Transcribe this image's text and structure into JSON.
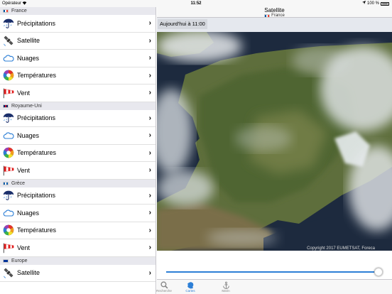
{
  "status": {
    "carrier": "Opérateur",
    "time": "11:52",
    "battery": "100 %"
  },
  "nav": {
    "title": "Satellite",
    "subtitle": "France"
  },
  "time_label": "Aujourd'hui à 11:00",
  "copyright": "Copyright 2017 EUMETSAT, Foreca",
  "sections": [
    {
      "name": "France",
      "flag": [
        "#0055a4",
        "#ffffff",
        "#ef4135"
      ],
      "items": [
        {
          "label": "Précipitations",
          "icon": "umbrella-icon"
        },
        {
          "label": "Satellite",
          "icon": "satellite-icon"
        },
        {
          "label": "Nuages",
          "icon": "cloud-icon"
        },
        {
          "label": "Températures",
          "icon": "color-wheel-icon"
        },
        {
          "label": "Vent",
          "icon": "windsock-icon"
        }
      ]
    },
    {
      "name": "Royaume-Uni",
      "flag": [
        "#012169",
        "#c8102e",
        "#012169"
      ],
      "items": [
        {
          "label": "Précipitations",
          "icon": "umbrella-icon"
        },
        {
          "label": "Nuages",
          "icon": "cloud-icon"
        },
        {
          "label": "Températures",
          "icon": "color-wheel-icon"
        },
        {
          "label": "Vent",
          "icon": "windsock-icon"
        }
      ]
    },
    {
      "name": "Grèce",
      "flag": [
        "#0d5eaf",
        "#ffffff",
        "#0d5eaf"
      ],
      "items": [
        {
          "label": "Précipitations",
          "icon": "umbrella-icon"
        },
        {
          "label": "Nuages",
          "icon": "cloud-icon"
        },
        {
          "label": "Températures",
          "icon": "color-wheel-icon"
        },
        {
          "label": "Vent",
          "icon": "windsock-icon"
        }
      ]
    },
    {
      "name": "Europe",
      "flag": [
        "#003399",
        "#003399",
        "#003399"
      ],
      "items": [
        {
          "label": "Satellite",
          "icon": "satellite-icon"
        }
      ]
    }
  ],
  "slider": {
    "value": 1.0
  },
  "tabs": [
    {
      "label": "Recherche",
      "icon": "magnifier-icon",
      "active": false
    },
    {
      "label": "Cartes",
      "icon": "france-map-icon",
      "active": true
    },
    {
      "label": "Marin",
      "icon": "anchor-icon",
      "active": false
    }
  ],
  "colors": {
    "accent": "#2d7fd6"
  }
}
